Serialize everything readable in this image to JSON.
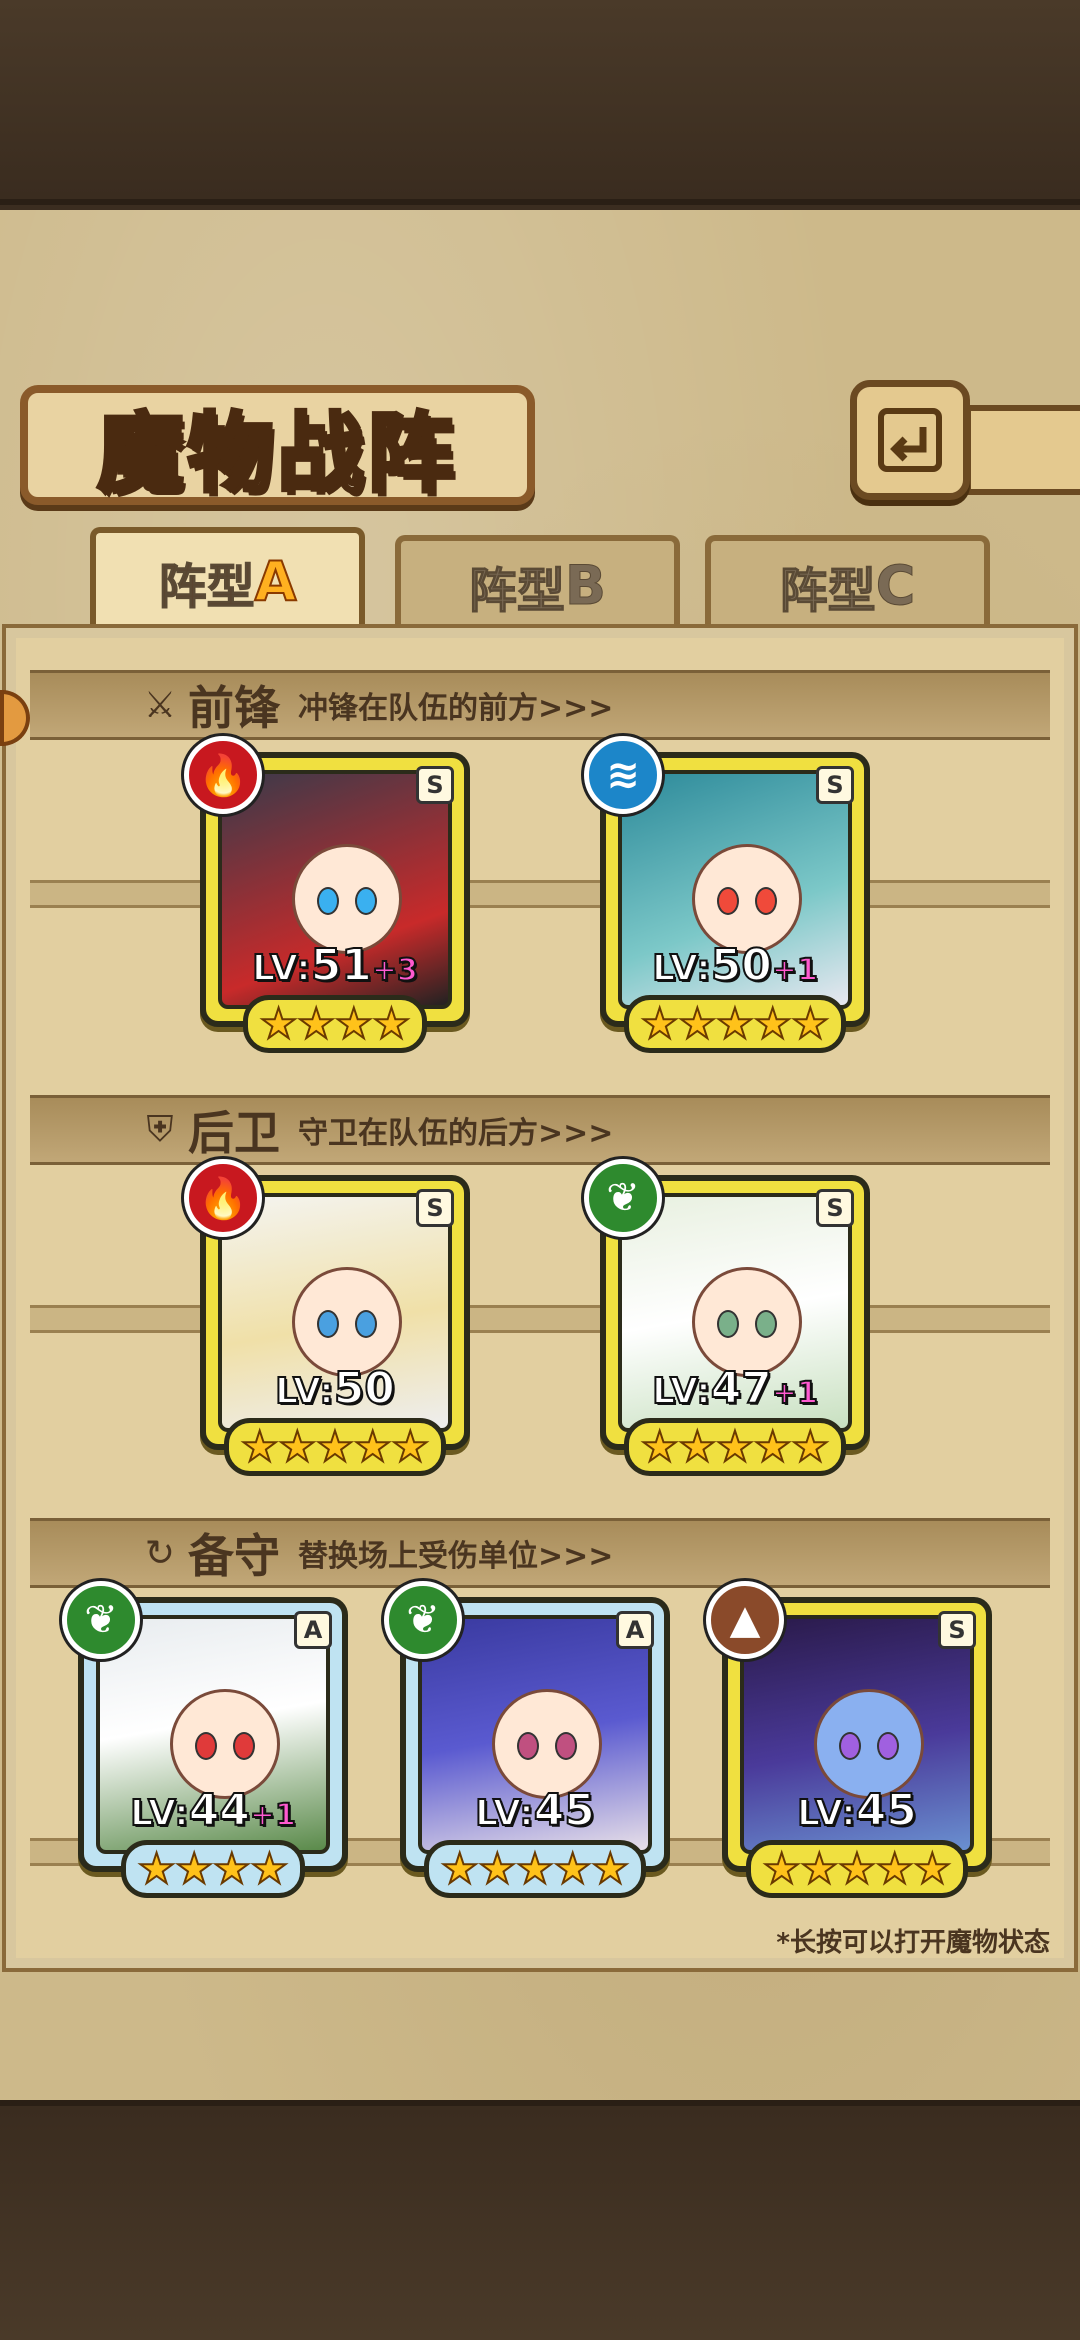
{
  "header": {
    "title": "魔物战阵"
  },
  "tabs": [
    {
      "label": "阵型",
      "letter": "A",
      "active": true
    },
    {
      "label": "阵型",
      "letter": "B",
      "active": false
    },
    {
      "label": "阵型",
      "letter": "C",
      "active": false
    }
  ],
  "sections": {
    "front": {
      "title": "前锋",
      "desc": "冲锋在队伍的前方>>>",
      "icon": "sword-icon"
    },
    "rear": {
      "title": "后卫",
      "desc": "守卫在队伍的后方>>>",
      "icon": "shield-icon"
    },
    "reserve": {
      "title": "备守",
      "desc": "替换场上受伤单位>>>",
      "icon": "swap-icon"
    }
  },
  "units": {
    "front": [
      {
        "element": "fire",
        "rank": "S",
        "level_prefix": "LV:",
        "level": "51",
        "plus": "+3",
        "stars": 4
      },
      {
        "element": "water",
        "rank": "S",
        "level_prefix": "LV:",
        "level": "50",
        "plus": "+1",
        "stars": 5
      }
    ],
    "rear": [
      {
        "element": "fire",
        "rank": "S",
        "level_prefix": "LV:",
        "level": "50",
        "plus": "",
        "stars": 5
      },
      {
        "element": "wood",
        "rank": "S",
        "level_prefix": "LV:",
        "level": "47",
        "plus": "+1",
        "stars": 5
      }
    ],
    "reserve": [
      {
        "element": "wood",
        "rank": "A",
        "level_prefix": "LV:",
        "level": "44",
        "plus": "+1",
        "stars": 4
      },
      {
        "element": "wood",
        "rank": "A",
        "level_prefix": "LV:",
        "level": "45",
        "plus": "",
        "stars": 5
      },
      {
        "element": "earth",
        "rank": "S",
        "level_prefix": "LV:",
        "level": "45",
        "plus": "",
        "stars": 5
      }
    ]
  },
  "footnote": "*长按可以打开魔物状态",
  "colors": {
    "fire": "#c8181f",
    "water": "#1c86c9",
    "wood": "#2e8a2e",
    "earth": "#8a4a2a"
  },
  "icons": {
    "back": "back-arrow-icon",
    "fire": "flame-icon",
    "water": "wave-icon",
    "wood": "leaf-icon",
    "earth": "mountain-icon",
    "star": "star-icon"
  }
}
